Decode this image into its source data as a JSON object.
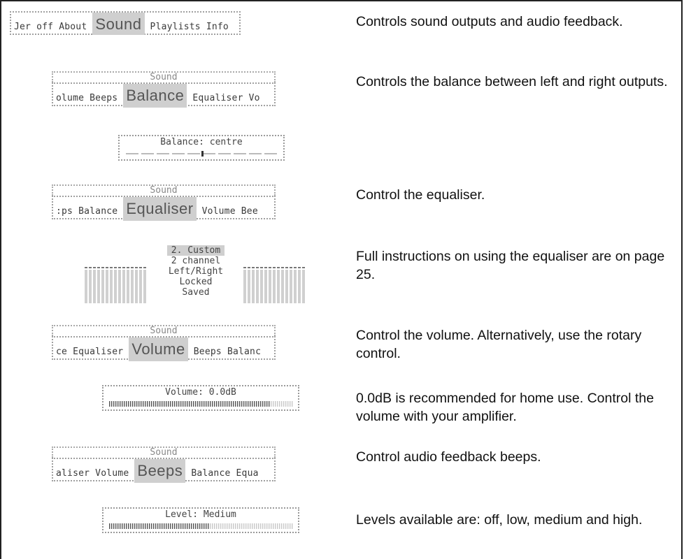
{
  "top_menu": {
    "items_left": "Jer off About",
    "selected": "Sound",
    "items_right": "Playlists Info",
    "description": "Controls sound outputs and audio feedback."
  },
  "balance_menu": {
    "title": "Sound",
    "items_left": "olume Beeps",
    "selected": "Balance",
    "items_right": "Equaliser Vo",
    "description": "Controls the balance between left and right outputs."
  },
  "balance_gauge": {
    "label": "Balance: centre",
    "position": 0.5
  },
  "equaliser_menu": {
    "title": "Sound",
    "items_left": ":ps Balance",
    "selected": "Equaliser",
    "items_right": "Volume Bee",
    "description": "Control the equaliser."
  },
  "equaliser_preset": {
    "items": [
      "2. Custom",
      "2 channel",
      "Left/Right",
      "Locked",
      "Saved"
    ],
    "highlighted_index": 0,
    "description": "Full instructions on using the equaliser are on page 25."
  },
  "volume_menu": {
    "title": "Sound",
    "items_left": "ce Equaliser",
    "selected": "Volume",
    "items_right": "Beeps Balanc",
    "description": "Control the volume. Alternatively, use the rotary control."
  },
  "volume_gauge": {
    "label": "Volume: 0.0dB",
    "level": 0.88,
    "description": "0.0dB is recommended for home use. Control the volume with your amplifier."
  },
  "beeps_menu": {
    "title": "Sound",
    "items_left": "aliser Volume",
    "selected": "Beeps",
    "items_right": "Balance Equa",
    "description": "Control audio feedback beeps."
  },
  "level_gauge": {
    "label": "Level: Medium",
    "level": 0.55,
    "description": "Levels available are: off, low, medium and high."
  },
  "colors": {
    "lcd_text": "#3a3a3a",
    "lcd_highlight": "#cfcfcf",
    "lcd_dots": "#9a9a9a"
  }
}
